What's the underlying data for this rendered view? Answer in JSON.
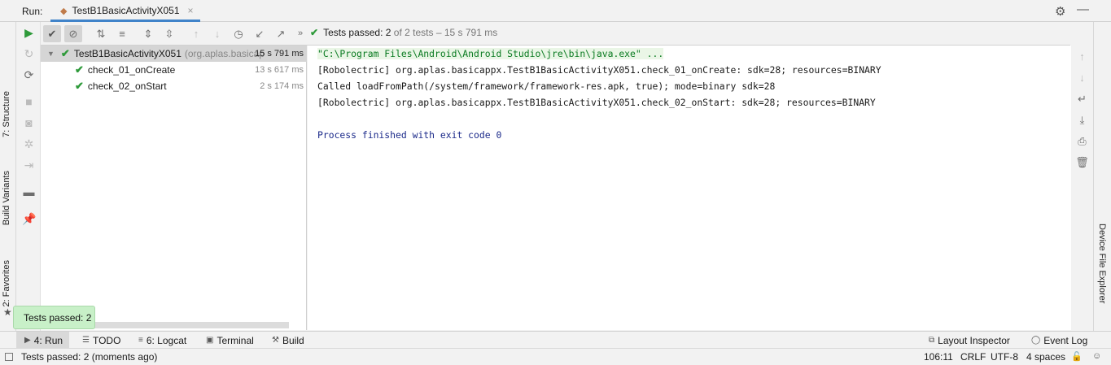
{
  "header": {
    "run_label": "Run:",
    "tab_title": "TestB1BasicActivityX051",
    "tab_close": "×"
  },
  "left_tool_windows": [
    "7: Structure",
    "Build Variants",
    "2: Favorites"
  ],
  "right_tool_windows": [
    "Device File Explorer"
  ],
  "status": {
    "passed_label": "Tests passed: 2",
    "detail": "of 2 tests – 15 s 791 ms"
  },
  "tree": {
    "root": {
      "name": "TestB1BasicActivityX051",
      "package": "(org.aplas.basicap",
      "time": "15 s 791 ms"
    },
    "children": [
      {
        "name": "check_01_onCreate",
        "time": "13 s 617 ms"
      },
      {
        "name": "check_02_onStart",
        "time": "2 s 174 ms"
      }
    ]
  },
  "console": {
    "lines": [
      "\"C:\\Program Files\\Android\\Android Studio\\jre\\bin\\java.exe\" ...",
      "[Robolectric] org.aplas.basicappx.TestB1BasicActivityX051.check_01_onCreate: sdk=28; resources=BINARY",
      "Called loadFromPath(/system/framework/framework-res.apk, true); mode=binary sdk=28",
      "[Robolectric] org.aplas.basicappx.TestB1BasicActivityX051.check_02_onStart: sdk=28; resources=BINARY",
      "",
      "Process finished with exit code 0"
    ]
  },
  "balloon": "Tests passed: 2",
  "bottom_tabs": {
    "run": "4: Run",
    "todo": "TODO",
    "logcat": "6: Logcat",
    "terminal": "Terminal",
    "build": "Build",
    "layout_inspector": "Layout Inspector",
    "event_log": "Event Log"
  },
  "statusbar": {
    "message": "Tests passed: 2 (moments ago)",
    "position": "106:11",
    "line_sep": "CRLF",
    "encoding": "UTF-8",
    "indent": "4 spaces"
  },
  "colors": {
    "pass": "#2e9a3a",
    "accent": "#4083c9",
    "balloon": "#c8f0c8"
  }
}
